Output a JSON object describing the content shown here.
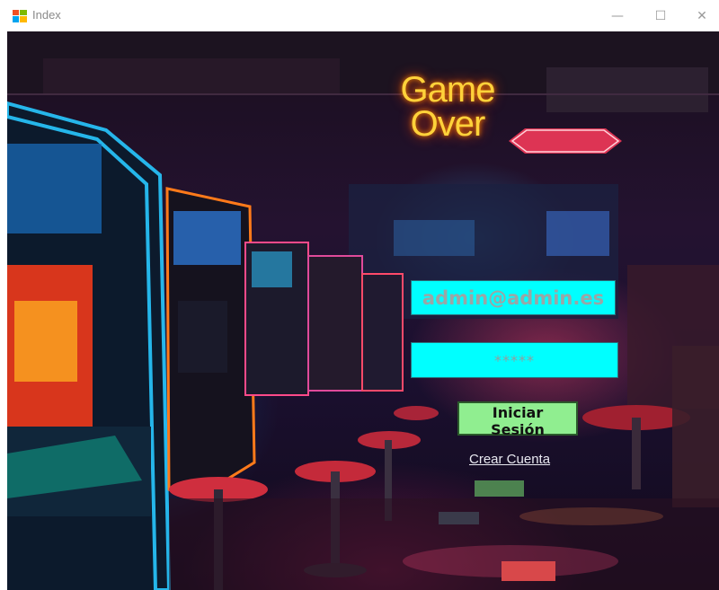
{
  "window": {
    "title": "Index",
    "controls": {
      "minimize": "—",
      "maximize": "☐",
      "close": "✕"
    },
    "icon": "app-window-icon"
  },
  "login": {
    "email_value": "admin@admin.es",
    "password_value": "*****",
    "submit_label": "Iniciar Sesión",
    "create_account_label": "Crear Cuenta"
  },
  "background": {
    "neon_sign_line1": "Game",
    "neon_sign_line2": "Over"
  },
  "colors": {
    "input_bg": "#00ffff",
    "button_bg": "#90ee90",
    "neon_yellow": "#ffd23a"
  }
}
